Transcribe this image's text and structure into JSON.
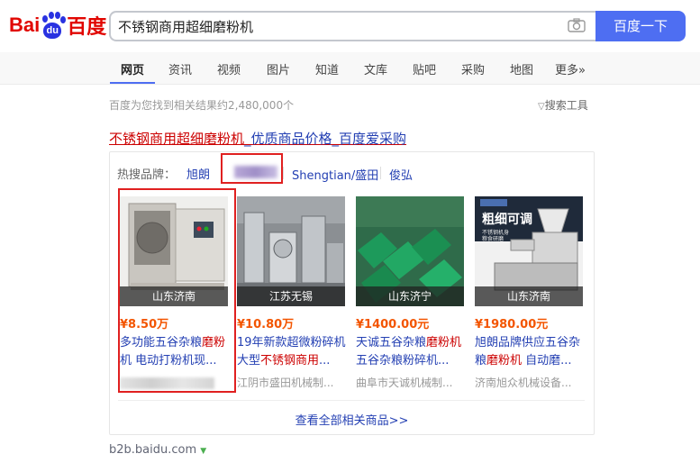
{
  "logo": {
    "latin_left": "Bai",
    "paw_text": "du",
    "cn": "百度"
  },
  "search": {
    "query": "不锈钢商用超细磨粉机",
    "button": "百度一下"
  },
  "tabs": [
    "网页",
    "资讯",
    "视频",
    "图片",
    "知道",
    "文库",
    "贴吧",
    "采购",
    "地图",
    "更多»"
  ],
  "stats": "百度为您找到相关结果约2,480,000个",
  "tools": "搜索工具",
  "ad": {
    "title_part1": "不锈钢商用超细磨粉机",
    "title_part2": "_优质商品价格_百度爱采购"
  },
  "brands": {
    "label": "热搜品牌：",
    "items": [
      "旭朗",
      "Shengtian/盛田",
      "俊弘"
    ]
  },
  "products": [
    {
      "location": "山东济南",
      "price": "¥8.50万",
      "name_a": "多功能五谷杂粮",
      "name_hl": "磨粉",
      "name_b": "机 电动打粉机现...",
      "shop": ""
    },
    {
      "location": "江苏无锡",
      "price": "¥10.80万",
      "name_a": "19年新款超微粉碎机大型",
      "name_hl": "不锈钢商用",
      "name_b": "...",
      "shop": "江阴市盛田机械制..."
    },
    {
      "location": "山东济宁",
      "price": "¥1400.00元",
      "name_a": "天诚五谷杂粮",
      "name_hl": "磨粉机",
      "name_b": "五谷杂粮粉碎机...",
      "shop": "曲阜市天诚机械制..."
    },
    {
      "location": "山东济南",
      "price": "¥1980.00元",
      "name_a": "旭朗品牌供应五谷杂粮",
      "name_hl": "磨粉机",
      "name_b": " 自动磨...",
      "shop": "济南旭众机械设备..."
    }
  ],
  "product4_banner": {
    "big": "粗细可调",
    "small1": "不锈钢机身",
    "small2": "粮食研磨"
  },
  "more_link": "查看全部相关商品>>",
  "url": "b2b.baidu.com"
}
